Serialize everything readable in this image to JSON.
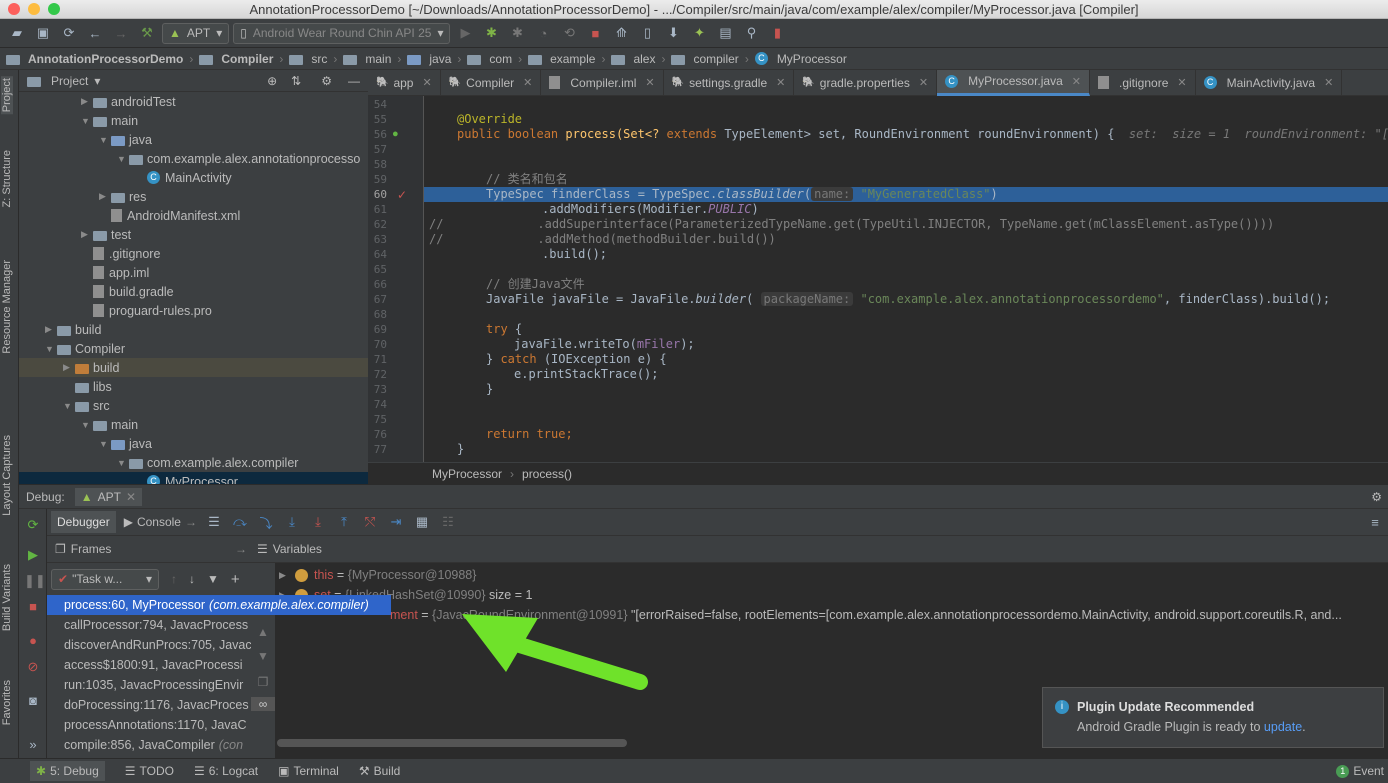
{
  "window": {
    "title": "AnnotationProcessorDemo [~/Downloads/AnnotationProcessorDemo] - .../Compiler/src/main/java/com/example/alex/compiler/MyProcessor.java [Compiler]"
  },
  "toolbar": {
    "run_config": "APT",
    "device": "Android Wear Round Chin API 25"
  },
  "breadcrumb": [
    "AnnotationProcessorDemo",
    "Compiler",
    "src",
    "main",
    "java",
    "com",
    "example",
    "alex",
    "compiler",
    "MyProcessor"
  ],
  "left_tools": [
    "Project",
    "Z: Structure",
    "Resource Manager",
    "Layout Captures",
    "Build Variants",
    "Favorites"
  ],
  "project_panel": {
    "title": "Project"
  },
  "tree": [
    {
      "label": "androidTest",
      "indent": 3,
      "icon": "folder",
      "arrow": "▶"
    },
    {
      "label": "main",
      "indent": 3,
      "icon": "folder",
      "arrow": "▼"
    },
    {
      "label": "java",
      "indent": 4,
      "icon": "folder-blue",
      "arrow": "▼"
    },
    {
      "label": "com.example.alex.annotationprocesso",
      "indent": 5,
      "icon": "folder",
      "arrow": "▼"
    },
    {
      "label": "MainActivity",
      "indent": 6,
      "icon": "class",
      "arrow": ""
    },
    {
      "label": "res",
      "indent": 4,
      "icon": "folder",
      "arrow": "▶"
    },
    {
      "label": "AndroidManifest.xml",
      "indent": 4,
      "icon": "file",
      "arrow": ""
    },
    {
      "label": "test",
      "indent": 3,
      "icon": "folder",
      "arrow": "▶"
    },
    {
      "label": ".gitignore",
      "indent": 3,
      "icon": "file",
      "arrow": ""
    },
    {
      "label": "app.iml",
      "indent": 3,
      "icon": "file",
      "arrow": ""
    },
    {
      "label": "build.gradle",
      "indent": 3,
      "icon": "file",
      "arrow": ""
    },
    {
      "label": "proguard-rules.pro",
      "indent": 3,
      "icon": "file",
      "arrow": ""
    },
    {
      "label": "build",
      "indent": 1,
      "icon": "folder",
      "arrow": "▶"
    },
    {
      "label": "Compiler",
      "indent": 1,
      "icon": "folder",
      "arrow": "▼"
    },
    {
      "label": "build",
      "indent": 2,
      "icon": "folder-orange",
      "arrow": "▶",
      "highlight": true
    },
    {
      "label": "libs",
      "indent": 2,
      "icon": "folder",
      "arrow": ""
    },
    {
      "label": "src",
      "indent": 2,
      "icon": "folder",
      "arrow": "▼"
    },
    {
      "label": "main",
      "indent": 3,
      "icon": "folder",
      "arrow": "▼"
    },
    {
      "label": "java",
      "indent": 4,
      "icon": "folder-blue",
      "arrow": "▼"
    },
    {
      "label": "com.example.alex.compiler",
      "indent": 5,
      "icon": "folder",
      "arrow": "▼"
    },
    {
      "label": "MyProcessor",
      "indent": 6,
      "icon": "class",
      "arrow": "",
      "selected": true
    }
  ],
  "editor_tabs": [
    {
      "label": "app",
      "active": false
    },
    {
      "label": "Compiler",
      "active": false
    },
    {
      "label": "Compiler.iml",
      "active": false
    },
    {
      "label": "settings.gradle",
      "active": false
    },
    {
      "label": "gradle.properties",
      "active": false
    },
    {
      "label": "MyProcessor.java",
      "active": true
    },
    {
      "label": ".gitignore",
      "active": false
    },
    {
      "label": "MainActivity.java",
      "active": false
    }
  ],
  "line_numbers": [
    "54",
    "55",
    "56",
    "57",
    "58",
    "59",
    "60",
    "61",
    "62",
    "63",
    "64",
    "65",
    "66",
    "67",
    "68",
    "69",
    "70",
    "71",
    "72",
    "73",
    "74",
    "75",
    "76",
    "77"
  ],
  "code": {
    "l55": "@Override",
    "l56a": "public boolean ",
    "l56b": "process(Set<? ",
    "l56c": "extends ",
    "l56d": "TypeElement> set, RoundEnvironment roundEnvironment) {  ",
    "l56hint": "set:  size = 1  roundEnvironment: \"[erro",
    "l59": "// 类名和包名",
    "l60a": "TypeSpec finderClass = TypeSpec.",
    "l60b": "classBuilder",
    "l60c": "(",
    "l60pn": "name:",
    "l60s": " \"MyGeneratedClass\"",
    "l60d": ")",
    "l61a": ".addModifiers(Modifier.",
    "l61b": "PUBLIC",
    "l61c": ")",
    "l62": "//             .addSuperinterface(ParameterizedTypeName.get(TypeUtil.INJECTOR, TypeName.get(mClassElement.asType())))",
    "l63": "//             .addMethod(methodBuilder.build())",
    "l64": ".build();",
    "l66": "// 创建Java文件",
    "l67a": "JavaFile javaFile = JavaFile.",
    "l67b": "builder",
    "l67c": "( ",
    "l67pn": "packageName:",
    "l67s": " \"com.example.alex.annotationprocessordemo\"",
    "l67d": ", finderClass).build();",
    "l69a": "try ",
    "l69b": "{",
    "l70a": "javaFile.writeTo(",
    "l70b": "mFiler",
    "l70c": ");",
    "l71a": "} ",
    "l71b": "catch ",
    "l71c": "(IOException e) {",
    "l72": "e.printStackTrace();",
    "l73": "}",
    "l76a": "return true",
    "l76b": ";",
    "l77": "}"
  },
  "crumb": {
    "cls": "MyProcessor",
    "method": "process()"
  },
  "debug": {
    "title": "Debug:",
    "config": "APT",
    "tab_debugger": "Debugger",
    "tab_console": "Console",
    "frames_title": "Frames",
    "variables_title": "Variables",
    "thread": "\"Task w...",
    "frames": [
      {
        "method": "process:60, MyProcessor",
        "pkg": "(com.example.alex.compiler)",
        "selected": true
      },
      {
        "method": "callProcessor:794, JavacProcess",
        "pkg": "",
        "selected": false
      },
      {
        "method": "discoverAndRunProcs:705, Javac",
        "pkg": "",
        "selected": false
      },
      {
        "method": "access$1800:91, JavacProcessi",
        "pkg": "",
        "selected": false
      },
      {
        "method": "run:1035, JavacProcessingEnvir",
        "pkg": "",
        "selected": false
      },
      {
        "method": "doProcessing:1176, JavacProces",
        "pkg": "",
        "selected": false
      },
      {
        "method": "processAnnotations:1170, JavaC",
        "pkg": "",
        "selected": false
      },
      {
        "method": "compile:856, JavaCompiler",
        "pkg": "(con",
        "selected": false
      }
    ],
    "variables": [
      {
        "name": "this",
        "type": "{MyProcessor@10988}",
        "value": ""
      },
      {
        "name": "set",
        "type": "{LinkedHashSet@10990}",
        "value": " size = 1"
      },
      {
        "name": "ment",
        "type": "{JavacRoundEnvironment@10991}",
        "value": " \"[errorRaised=false, rootElements=[com.example.alex.annotationprocessordemo.MainActivity, android.support.coreutils.R, and..."
      }
    ]
  },
  "notification": {
    "title": "Plugin Update Recommended",
    "body": "Android Gradle Plugin is ready to ",
    "link": "update",
    "tail": "."
  },
  "statusbar": {
    "debug": "5: Debug",
    "todo": "TODO",
    "logcat": "6: Logcat",
    "terminal": "Terminal",
    "build": "Build",
    "event": "Event",
    "event_count": "1"
  },
  "colors": {
    "accent": "#4a88c7",
    "selection": "#2f65ca",
    "arrow": "#6fe22a"
  }
}
